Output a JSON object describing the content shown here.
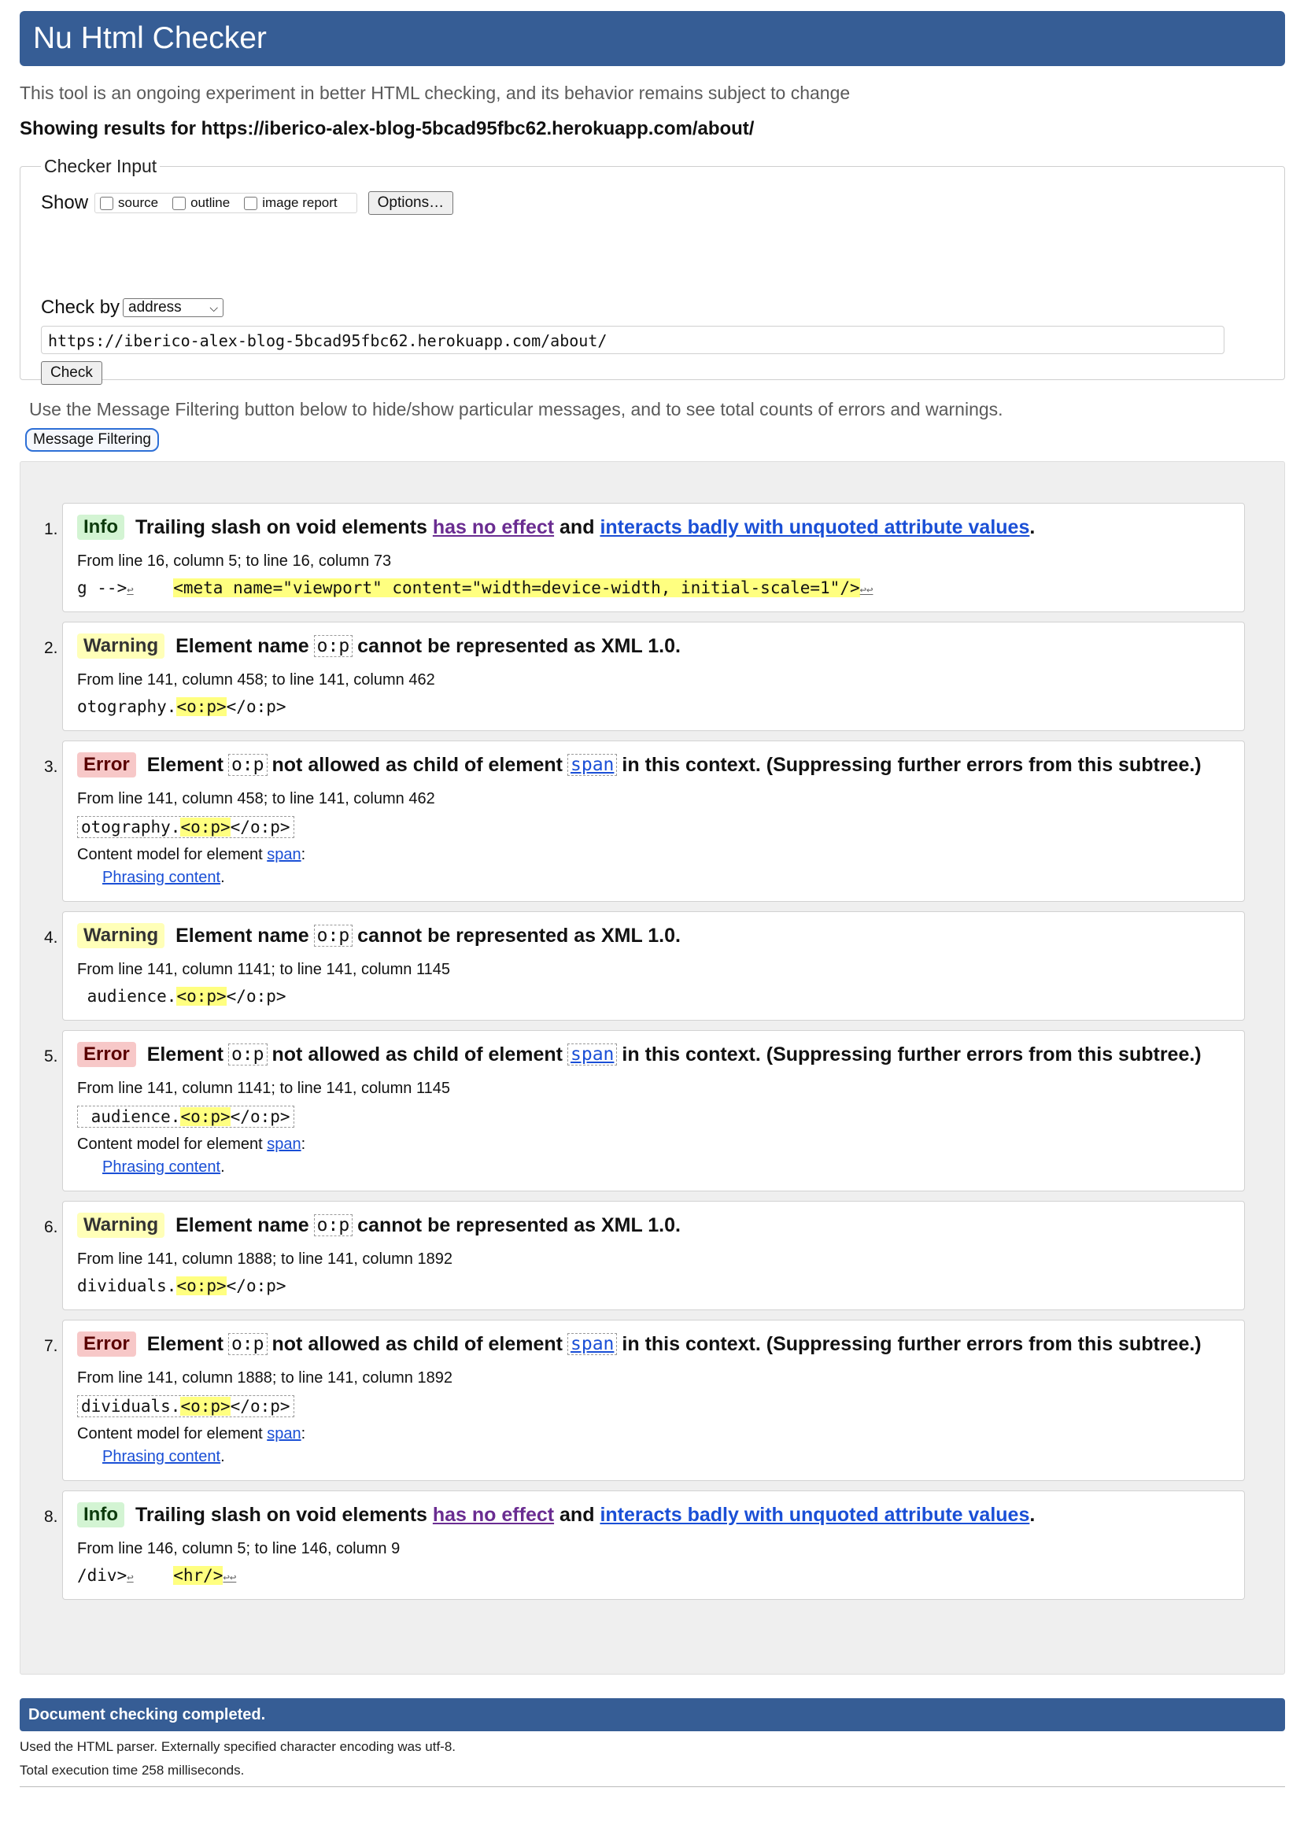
{
  "header": {
    "title": "Nu Html Checker"
  },
  "intro": "This tool is an ongoing experiment in better HTML checking, and its behavior remains subject to change",
  "showing": "Showing results for https://iberico-alex-blog-5bcad95fbc62.herokuapp.com/about/",
  "checker": {
    "legend": "Checker Input",
    "show_label": "Show",
    "options": [
      {
        "label": "source",
        "checked": false
      },
      {
        "label": "outline",
        "checked": false
      },
      {
        "label": "image report",
        "checked": false
      }
    ],
    "options_button": "Options…",
    "check_by_label": "Check by",
    "check_by_value": "address",
    "url_value": "https://iberico-alex-blog-5bcad95fbc62.herokuapp.com/about/",
    "check_button": "Check"
  },
  "filter": {
    "note": "Use the Message Filtering button below to hide/show particular messages, and to see total counts of errors and warnings.",
    "button": "Message Filtering"
  },
  "messages": [
    {
      "num": "1.",
      "type": "Info",
      "text1": "Trailing slash on void elements",
      "link1": "has no effect",
      "mid": "and",
      "link2": "interacts badly with unquoted attribute values",
      "end": ".",
      "loc": "From line 16, column 5; to line 16, column 73",
      "pre": "g -->",
      "lb1": "↩",
      "gap": "    ",
      "hl": "<meta name=\"viewport\" content=\"width=device-width, initial-scale=1\"/>",
      "post": "↩↩"
    },
    {
      "num": "2.",
      "type": "Warning",
      "text1": "Element name",
      "code": "o:p",
      "text2": "cannot be represented as XML 1.0.",
      "loc": "From line 141, column 458; to line 141, column 462",
      "pre": "otography.",
      "hl": "<o:p>",
      "post": "</o:p>"
    },
    {
      "num": "3.",
      "type": "Error",
      "text1": "Element",
      "code": "o:p",
      "text2": "not allowed as child of element",
      "code2": "span",
      "text3": "in this context. (Suppressing further errors from this subtree.)",
      "loc": "From line 141, column 458; to line 141, column 462",
      "pre": "otography.",
      "hl": "<o:p>",
      "post": "</o:p>",
      "cm_label": "Content model for element",
      "cm_link": "span",
      "cm_colon": ":",
      "cm_item": "Phrasing content",
      "cm_dot": "."
    },
    {
      "num": "4.",
      "type": "Warning",
      "text1": "Element name",
      "code": "o:p",
      "text2": "cannot be represented as XML 1.0.",
      "loc": "From line 141, column 1141; to line 141, column 1145",
      "pre": " audience.",
      "hl": "<o:p>",
      "post": "</o:p>"
    },
    {
      "num": "5.",
      "type": "Error",
      "text1": "Element",
      "code": "o:p",
      "text2": "not allowed as child of element",
      "code2": "span",
      "text3": "in this context. (Suppressing further errors from this subtree.)",
      "loc": "From line 141, column 1141; to line 141, column 1145",
      "pre": " audience.",
      "hl": "<o:p>",
      "post": "</o:p>",
      "cm_label": "Content model for element",
      "cm_link": "span",
      "cm_colon": ":",
      "cm_item": "Phrasing content",
      "cm_dot": "."
    },
    {
      "num": "6.",
      "type": "Warning",
      "text1": "Element name",
      "code": "o:p",
      "text2": "cannot be represented as XML 1.0.",
      "loc": "From line 141, column 1888; to line 141, column 1892",
      "pre": "dividuals.",
      "hl": "<o:p>",
      "post": "</o:p>"
    },
    {
      "num": "7.",
      "type": "Error",
      "text1": "Element",
      "code": "o:p",
      "text2": "not allowed as child of element",
      "code2": "span",
      "text3": "in this context. (Suppressing further errors from this subtree.)",
      "loc": "From line 141, column 1888; to line 141, column 1892",
      "pre": "dividuals.",
      "hl": "<o:p>",
      "post": "</o:p>",
      "cm_label": "Content model for element",
      "cm_link": "span",
      "cm_colon": ":",
      "cm_item": "Phrasing content",
      "cm_dot": "."
    },
    {
      "num": "8.",
      "type": "Info",
      "text1": "Trailing slash on void elements",
      "link1": "has no effect",
      "mid": "and",
      "link2": "interacts badly with unquoted attribute values",
      "end": ".",
      "loc": "From line 146, column 5; to line 146, column 9",
      "pre": "/div>",
      "lb1": "↩",
      "gap": "    ",
      "hl": "<hr/>",
      "post": "↩↩"
    }
  ],
  "done": "Document checking completed.",
  "footer": {
    "parser": "Used the HTML parser. Externally specified character encoding was utf-8.",
    "time": "Total execution time 258 milliseconds."
  },
  "colors": {
    "header_bg": "#365d95",
    "info": "#d3f4d3",
    "warning": "#ffffb8",
    "error": "#f7c8c8",
    "highlight": "#ffff80",
    "link": "#1a4fd6",
    "visited": "#6a2c91"
  }
}
